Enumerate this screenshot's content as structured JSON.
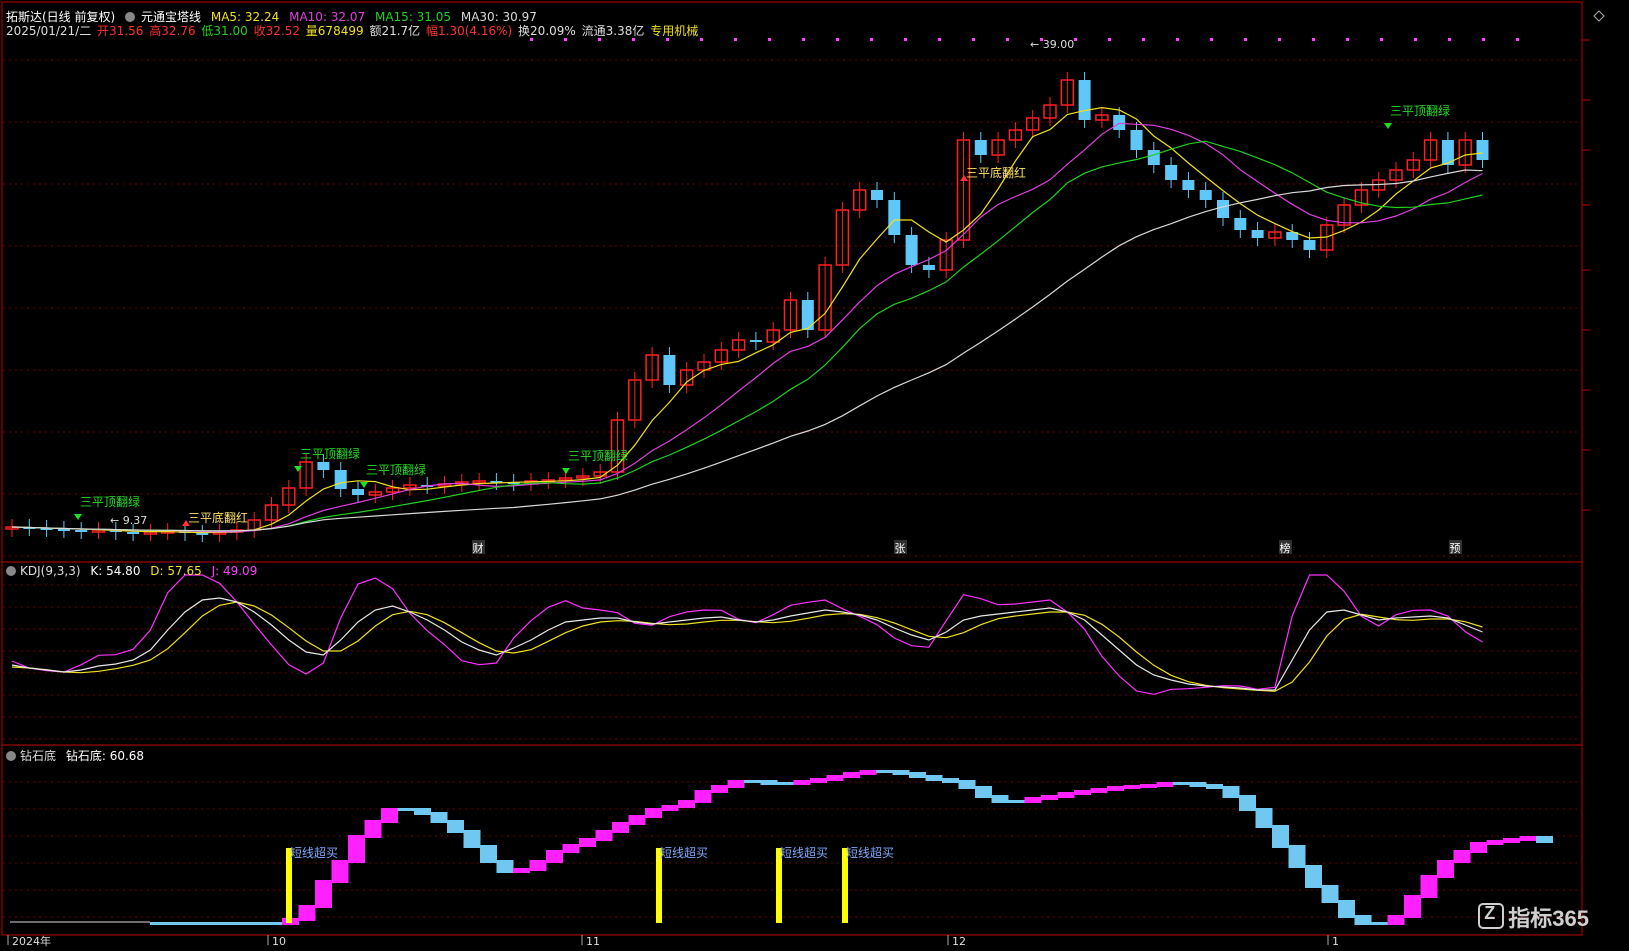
{
  "header": {
    "stock_name": "拓斯达(日线 前复权)",
    "indicator_name": "元通宝塔线",
    "ma5": "MA5: 32.24",
    "ma10": "MA10: 32.07",
    "ma15": "MA15: 31.05",
    "ma30": "MA30: 30.97",
    "date": "2025/01/21/二",
    "open": "开31.56",
    "high": "高32.76",
    "low": "低31.00",
    "close": "收32.52",
    "volume": "量678499",
    "amount": "额21.7亿",
    "change": "幅1.30(4.16%)",
    "turnover": "换20.09%",
    "float_cap": "流通3.38亿",
    "sector": "专用机械"
  },
  "colors": {
    "up": "#ff2020",
    "down": "#60c8f8",
    "ma5": "#f0e020",
    "ma10": "#e040e0",
    "ma15": "#20d020",
    "ma30": "#d8d8d8",
    "grid": "#700000",
    "border": "#c00000",
    "magenta": "#ff20ff",
    "lightblue": "#70c8f0",
    "yellow": "#ffff00"
  },
  "main": {
    "high_label": "39.00",
    "low_label": "9.37",
    "signals": [
      "三平顶翻绿",
      "三平底翻红",
      "三平顶翻绿",
      "三平顶翻绿",
      "三平顶翻绿",
      "三平底翻红",
      "三平顶翻绿"
    ],
    "event_markers": [
      "财",
      "张",
      "榜",
      "预"
    ]
  },
  "kdj": {
    "title": "KDJ(9,3,3)",
    "k": "K: 54.80",
    "d": "D: 57.65",
    "j": "J: 49.09"
  },
  "diamond": {
    "title": "钻石底",
    "value": "钻石底: 60.68",
    "buy_labels": [
      "短线超买",
      "短线超买",
      "短线超买",
      "短线超买"
    ]
  },
  "xaxis": {
    "labels": [
      "2024年",
      "10",
      "11",
      "12",
      "1"
    ]
  },
  "watermark": "指标365",
  "icons": [
    "settings-circle-icon",
    "diamond-icon"
  ]
}
